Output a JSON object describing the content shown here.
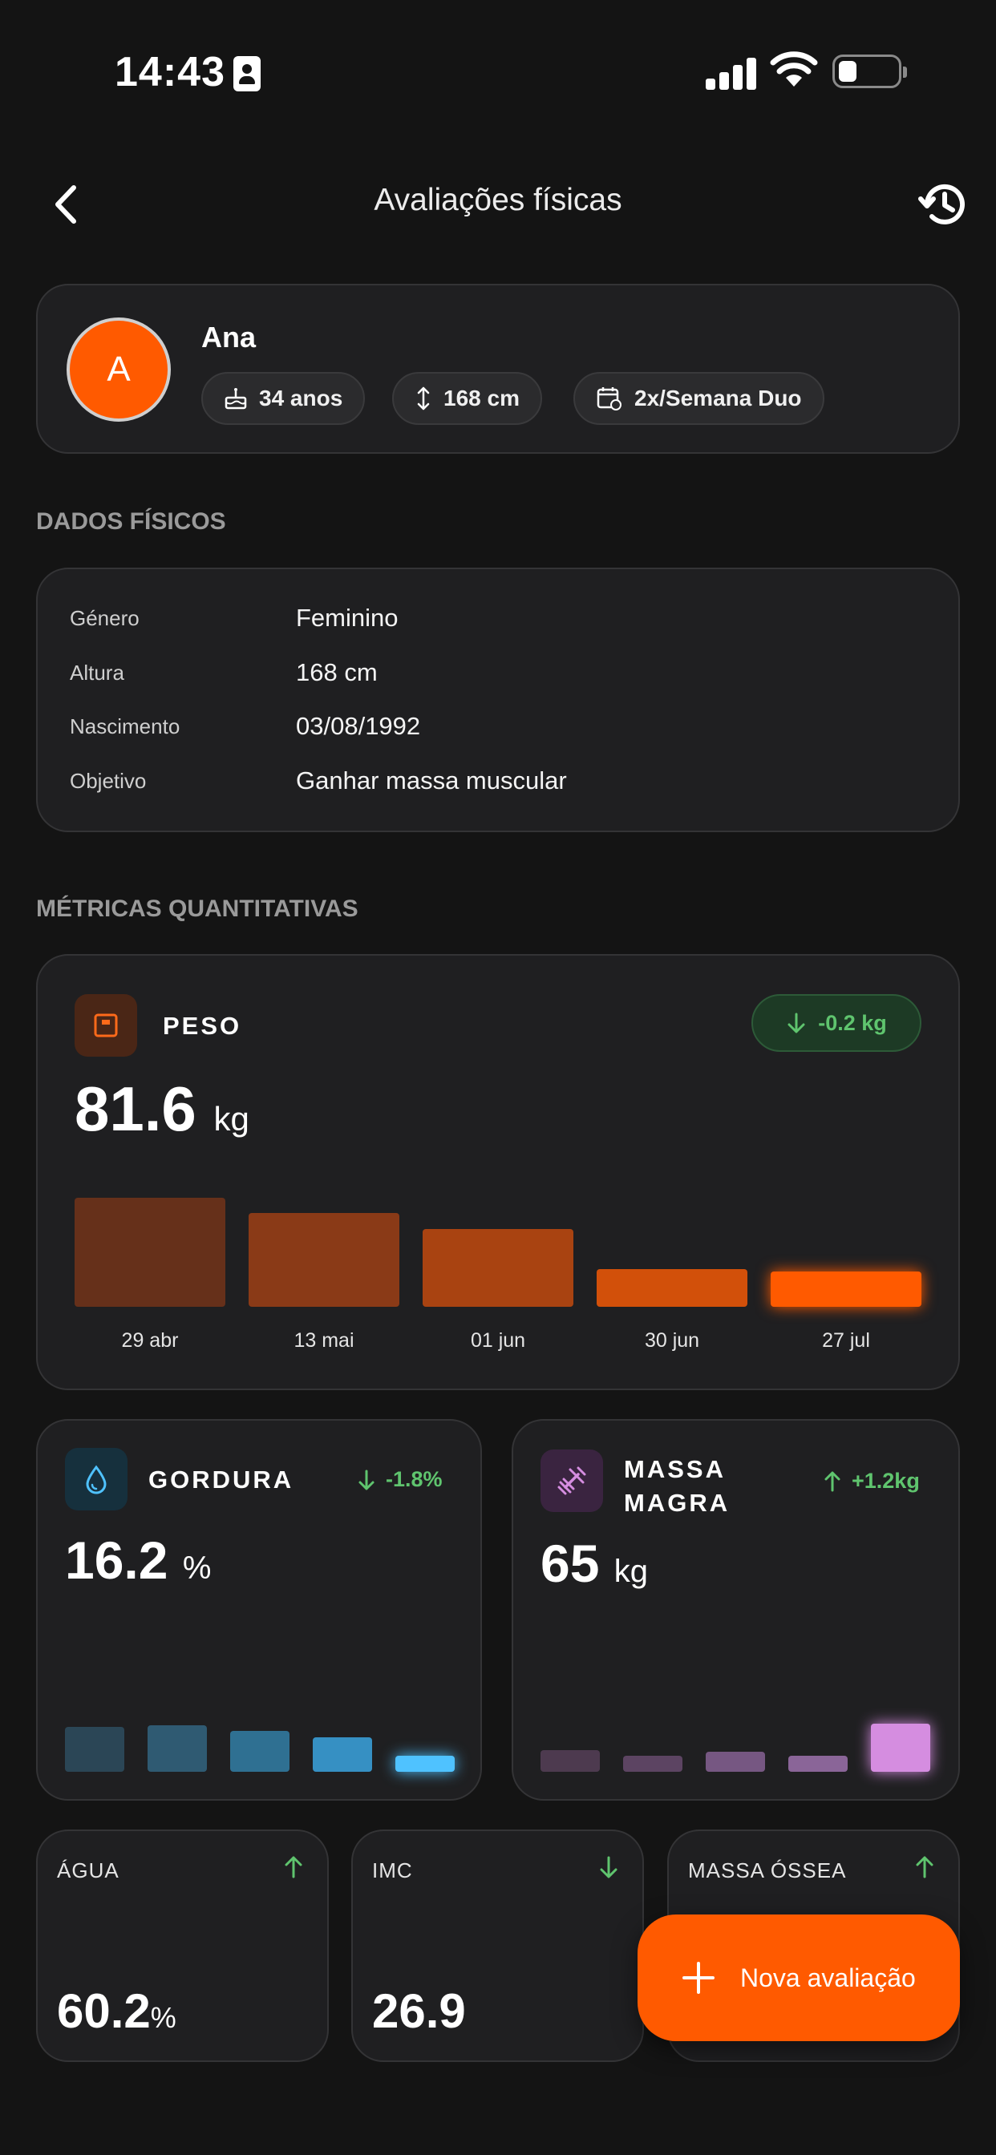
{
  "status_bar": {
    "time": "14:43"
  },
  "nav": {
    "title": "Avaliações físicas"
  },
  "profile": {
    "initial": "A",
    "name": "Ana",
    "age": "34 anos",
    "height": "168 cm",
    "plan": "2x/Semana Duo"
  },
  "physical_section": {
    "title": "DADOS FÍSICOS",
    "rows": [
      {
        "label": "Género",
        "value": "Feminino"
      },
      {
        "label": "Altura",
        "value": "168 cm"
      },
      {
        "label": "Nascimento",
        "value": "03/08/1992"
      },
      {
        "label": "Objetivo",
        "value": "Ganhar massa muscular"
      }
    ]
  },
  "metrics_section": {
    "title": "MÉTRICAS QUANTITATIVAS"
  },
  "peso": {
    "label": "PESO",
    "value": "81.6",
    "unit": "kg",
    "delta": "-0.2 kg",
    "dates": [
      "29 abr",
      "13 mai",
      "01 jun",
      "30 jun",
      "27 jul"
    ],
    "colors": [
      "#66301a",
      "#8a3a17",
      "#a94311",
      "#d2500a",
      "#ff5a00"
    ]
  },
  "gordura": {
    "label": "GORDURA",
    "value": "16.2",
    "unit": "%",
    "delta": "-1.8%",
    "colors": [
      "#2b4656",
      "#2f5a72",
      "#2f7092",
      "#3690c3",
      "#4fc2ff"
    ]
  },
  "massa_magra": {
    "label_line1": "MASSA",
    "label_line2": "MAGRA",
    "value": "65",
    "unit": "kg",
    "delta": "+1.2kg",
    "colors": [
      "#4d3a4f",
      "#5c4462",
      "#765782",
      "#8a6598",
      "#d58de0"
    ]
  },
  "mini": [
    {
      "label": "ÁGUA",
      "value": "60.2",
      "unit": "%",
      "trend": "up"
    },
    {
      "label": "IMC",
      "value": "26.9",
      "unit": "",
      "trend": "down"
    },
    {
      "label": "MASSA ÓSSEA",
      "value": "",
      "unit": "",
      "trend": "up"
    }
  ],
  "fab": {
    "label": "Nova avaliação"
  },
  "chart_data": [
    {
      "type": "bar",
      "title": "PESO",
      "categories": [
        "29 abr",
        "13 mai",
        "01 jun",
        "30 jun",
        "27 jul"
      ],
      "values": [
        81.85,
        81.8,
        81.75,
        81.62,
        81.6
      ],
      "ylim": [
        81.5,
        81.9
      ]
    },
    {
      "type": "bar",
      "title": "GORDURA",
      "values": [
        18.0,
        18.1,
        17.8,
        17.5,
        16.2
      ],
      "ylim": [
        15.8,
        18.4
      ]
    },
    {
      "type": "bar",
      "title": "MASSA MAGRA",
      "values": [
        63.8,
        63.2,
        63.7,
        63.5,
        65.0
      ],
      "ylim": [
        62.8,
        65.2
      ]
    }
  ]
}
